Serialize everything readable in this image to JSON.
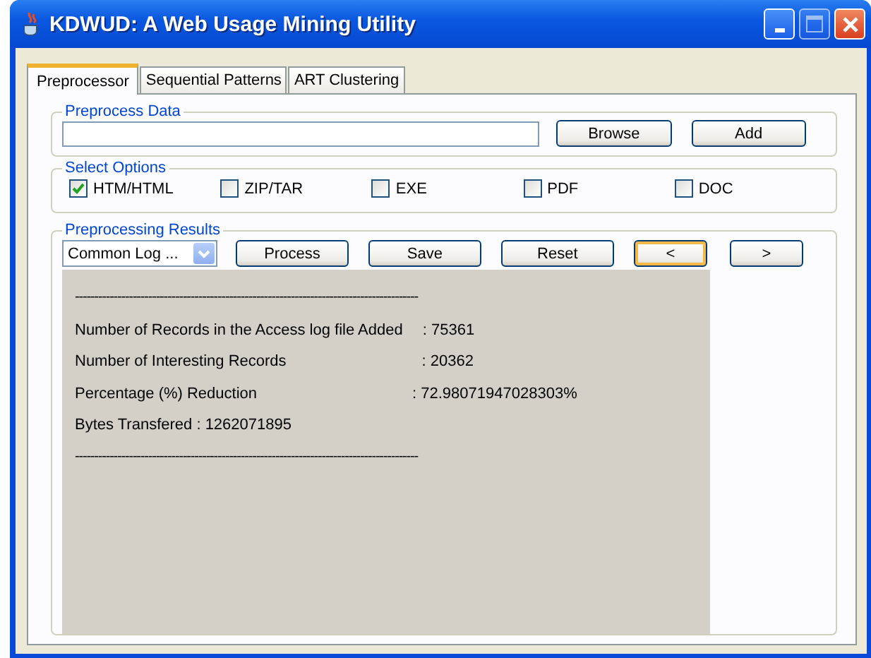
{
  "window": {
    "title": "KDWUD: A Web Usage Mining Utility"
  },
  "tabs": [
    {
      "label": "Preprocessor",
      "selected": true
    },
    {
      "label": "Sequential Patterns",
      "selected": false
    },
    {
      "label": "ART Clustering",
      "selected": false
    }
  ],
  "preprocess_data": {
    "title": "Preprocess Data",
    "buttons": [
      "Browse",
      "Add"
    ]
  },
  "select_options": {
    "title": "Select Options",
    "options": [
      {
        "label": "HTM/HTML",
        "checked": true
      },
      {
        "label": "ZIP/TAR",
        "checked": false
      },
      {
        "label": "EXE",
        "checked": false
      },
      {
        "label": "PDF",
        "checked": false
      },
      {
        "label": "DOC",
        "checked": false
      }
    ]
  },
  "preprocessing_results": {
    "title": "Preprocessing Results",
    "format": "Common Log ...",
    "buttons": [
      {
        "label": "Process",
        "focused": false
      },
      {
        "label": "Save",
        "focused": false
      },
      {
        "label": "Reset",
        "focused": false
      },
      {
        "label": "<",
        "focused": true
      },
      {
        "label": ">",
        "focused": false
      }
    ],
    "output": [
      {
        "kind": "rule",
        "text": "-----------------------------------------------------------------------------------------"
      },
      {
        "kind": "pair",
        "label": "Number of Records in the Access log file Added",
        "value": ": 75361"
      },
      {
        "kind": "pair",
        "label": "Number of Interesting Records",
        "value": ": 20362"
      },
      {
        "kind": "pair",
        "label": "Percentage (%) Reduction",
        "value": ": 72.98071947028303%"
      },
      {
        "kind": "line",
        "text": "Bytes Transfered : 1262071895"
      },
      {
        "kind": "rule",
        "text": "-----------------------------------------------------------------------------------------"
      }
    ]
  }
}
